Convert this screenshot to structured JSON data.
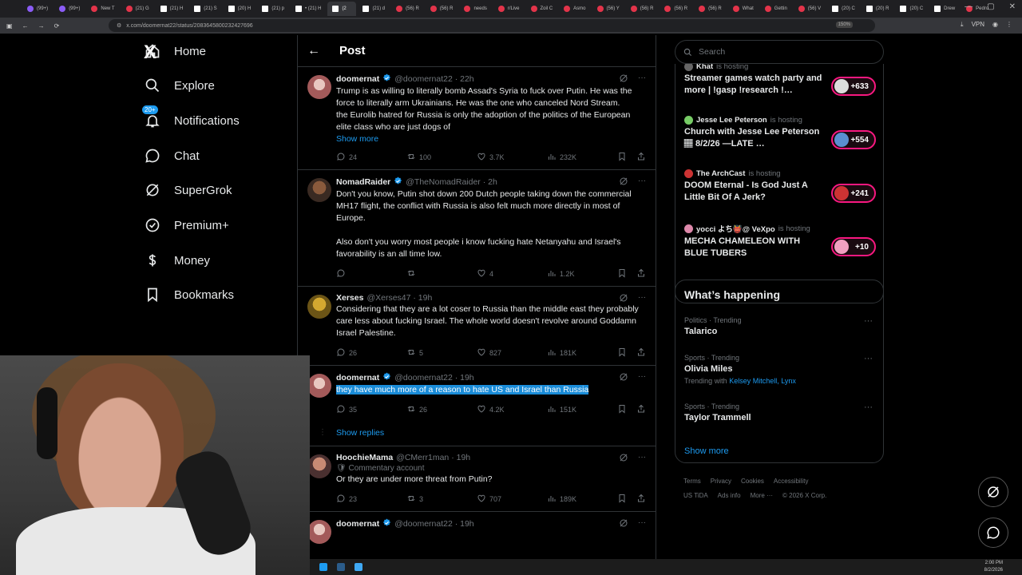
{
  "browser": {
    "tabs": [
      {
        "label": "(99+)",
        "fav": "p"
      },
      {
        "label": "(99+)",
        "fav": "p"
      },
      {
        "label": "New T",
        "fav": "r"
      },
      {
        "label": "(21) G",
        "fav": "r"
      },
      {
        "label": "(21) H",
        "fav": "x"
      },
      {
        "label": "(21) S",
        "fav": "x"
      },
      {
        "label": "(20) H",
        "fav": "x"
      },
      {
        "label": "(21) p",
        "fav": "x"
      },
      {
        "label": "• (21) H",
        "fav": "x"
      },
      {
        "label": "(2",
        "fav": "x",
        "active": true
      },
      {
        "label": "(21) d",
        "fav": "x"
      },
      {
        "label": "(56) R",
        "fav": "r"
      },
      {
        "label": "(56) R",
        "fav": "r"
      },
      {
        "label": "needs",
        "fav": "r"
      },
      {
        "label": "r/Live",
        "fav": "r"
      },
      {
        "label": "Zoil C",
        "fav": "r"
      },
      {
        "label": "Asmo",
        "fav": "r"
      },
      {
        "label": "(56) Y",
        "fav": "r"
      },
      {
        "label": "(56) R",
        "fav": "r"
      },
      {
        "label": "(56) R",
        "fav": "r"
      },
      {
        "label": "(56) R",
        "fav": "r"
      },
      {
        "label": "What",
        "fav": "r"
      },
      {
        "label": "Gettin",
        "fav": "r"
      },
      {
        "label": "(56) V",
        "fav": "r"
      },
      {
        "label": "(20) C",
        "fav": "x"
      },
      {
        "label": "(20) R",
        "fav": "x"
      },
      {
        "label": "(20) C",
        "fav": "x"
      },
      {
        "label": "Drew",
        "fav": "x"
      },
      {
        "label": "Pedro",
        "fav": "r"
      }
    ],
    "url": "x.com/doomernat22/status/2083645800232427696",
    "zoom": "150%",
    "vpn": "VPN"
  },
  "nav": {
    "logo": "X",
    "items": [
      {
        "label": "Home",
        "icon": "home-icon"
      },
      {
        "label": "Explore",
        "icon": "search-icon"
      },
      {
        "label": "Notifications",
        "icon": "bell-icon",
        "badge": "20+"
      },
      {
        "label": "Chat",
        "icon": "chat-icon"
      },
      {
        "label": "SuperGrok",
        "icon": "grok-icon"
      },
      {
        "label": "Premium+",
        "icon": "premium-icon"
      },
      {
        "label": "Money",
        "icon": "money-icon"
      },
      {
        "label": "Bookmarks",
        "icon": "bookmark-icon"
      }
    ]
  },
  "header": {
    "title": "Post"
  },
  "tweets": [
    {
      "name": "doomernat",
      "handle": "@doomernat22 · 22h",
      "verified": true,
      "text": "Trump is as willing to literally bomb Assad's Syria to fuck over Putin. He was the force to literally arm Ukrainians. He was the one who canceled Nord Stream.\nthe Eurolib hatred for Russia is only the adoption of the politics of the European elite class who are just dogs of",
      "more": "Show more",
      "replies": "24",
      "reposts": "100",
      "likes": "3.7K",
      "views": "232K"
    },
    {
      "name": "NomadRaider",
      "handle": "@TheNomadRaider · 2h",
      "verified": true,
      "text": "Don't you know, Putin shot down 200 Dutch people taking down the commercial MH17 flight, the conflict with Russia is also felt much more directly in most of Europe.\n\nAlso don't you worry most people i know fucking hate Netanyahu and Israel's favorability is an all time low.",
      "replies": "",
      "reposts": "",
      "likes": "4",
      "views": "1.2K"
    },
    {
      "name": "Xerses",
      "handle": "@Xerses47 · 19h",
      "verified": false,
      "text": "Considering that they are a lot coser to Russia than the middle east they probably care less about fucking Israel. The whole world doesn't revolve around Goddamn Israel Palestine.",
      "replies": "26",
      "reposts": "5",
      "likes": "827",
      "views": "181K"
    },
    {
      "name": "doomernat",
      "handle": "@doomernat22 · 19h",
      "verified": true,
      "text": "they have much more of a reason to hate US and Israel than Russia",
      "replies": "35",
      "reposts": "26",
      "likes": "4.2K",
      "views": "151K"
    },
    {
      "name": "HoochieMama",
      "handle": "@CMerr1man · 19h",
      "verified": false,
      "commentary": "Commentary account",
      "text": "Or they are under more threat from Putin?",
      "replies": "23",
      "reposts": "3",
      "likes": "707",
      "views": "189K"
    },
    {
      "name": "doomernat",
      "handle": "@doomernat22 · 19h",
      "verified": true
    }
  ],
  "show_replies": "Show replies",
  "right": {
    "search_placeholder": "Search",
    "spaces": [
      {
        "host": "Khat",
        "hosting": "is hosting",
        "title": "Streamer games watch party and more | !gasp !research !…",
        "count": "+633"
      },
      {
        "host": "Jesse Lee Peterson",
        "hosting": "is hosting",
        "title": "Church with Jesse Lee Peterson 🏽 8/2/26 —LATE …",
        "count": "+554"
      },
      {
        "host": "The ArchCast",
        "hosting": "is hosting",
        "title": "DOOM Eternal - Is God Just A Little Bit Of A Jerk?",
        "count": "+241"
      },
      {
        "host": "yocci よち👹@ VeXpo",
        "hosting": "is hosting",
        "title": "MECHA CHAMELEON WITH BLUE TUBERS",
        "count": "+10"
      }
    ],
    "happening_title": "What’s happening",
    "trends": [
      {
        "meta": "Politics · Trending",
        "name": "Talarico",
        "with": ""
      },
      {
        "meta": "Sports · Trending",
        "name": "Olivia Miles",
        "with_label": "Trending with",
        "with": "Kelsey Mitchell, Lynx"
      },
      {
        "meta": "Sports · Trending",
        "name": "Taylor Trammell",
        "with": ""
      }
    ],
    "show_more": "Show more",
    "footer": [
      "Terms",
      "Privacy",
      "Cookies",
      "Accessibility",
      "US TiDA",
      "Ads info",
      "More ···",
      "© 2026 X Corp."
    ]
  },
  "clock": {
    "time": "2:00 PM",
    "date": "8/2/2026"
  },
  "colors": {
    "accent": "#1d9bf0",
    "space_ring": "#f91880",
    "highlight": "#1a8cd8"
  }
}
